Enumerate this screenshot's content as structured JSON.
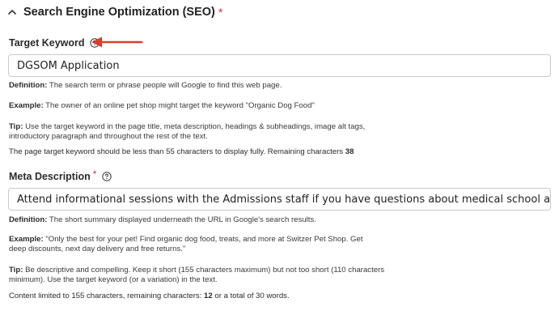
{
  "seo": {
    "title": "Search Engine Optimization (SEO)",
    "required_mark": "*"
  },
  "target_keyword": {
    "label": "Target Keyword",
    "value": "DGSOM Application",
    "definition_label": "Definition:",
    "definition_text": " The search term or phrase people will Google to find this web page.",
    "example_label": "Example:",
    "example_text": " The owner of an online pet shop might target the keyword \"Organic Dog Food\"",
    "tip_label": "Tip:",
    "tip_text": " Use the target keyword in the page title, meta description, headings & subheadings, image alt tags, introductory paragraph and throughout the rest of the text.",
    "count_text": "The page target keyword should be less than 55 characters to display fully. Remaining characters ",
    "count_value": "38"
  },
  "meta_description": {
    "label": "Meta Description",
    "required_mark": "*",
    "value": "Attend informational sessions with the Admissions staff if you have questions about medical school applications and",
    "definition_label": "Definition:",
    "definition_text": " The short summary displayed underneath the URL in Google's search results.",
    "example_label": "Example:",
    "example_text": " \"Only the best for your pet! Find organic dog food, treats, and more at Switzer Pet Shop. Get deep discounts, next day delivery and free returns.\"",
    "tip_label": "Tip:",
    "tip_text": " Be descriptive and compelling. Keep it short (155 characters maximum) but not too short (110 characters minimum). Use the target keyword (or a variation) in the text.",
    "count_prefix": "Content limited to 155 characters, remaining characters: ",
    "count_value": "12",
    "count_suffix": " or a total of 30 words."
  },
  "colors": {
    "required": "#d0312d",
    "arrow": "#e03a2a"
  },
  "icons": {
    "collapse": "chevron-up-icon",
    "help": "question-circle-icon",
    "annotation": "arrow-left-icon"
  }
}
